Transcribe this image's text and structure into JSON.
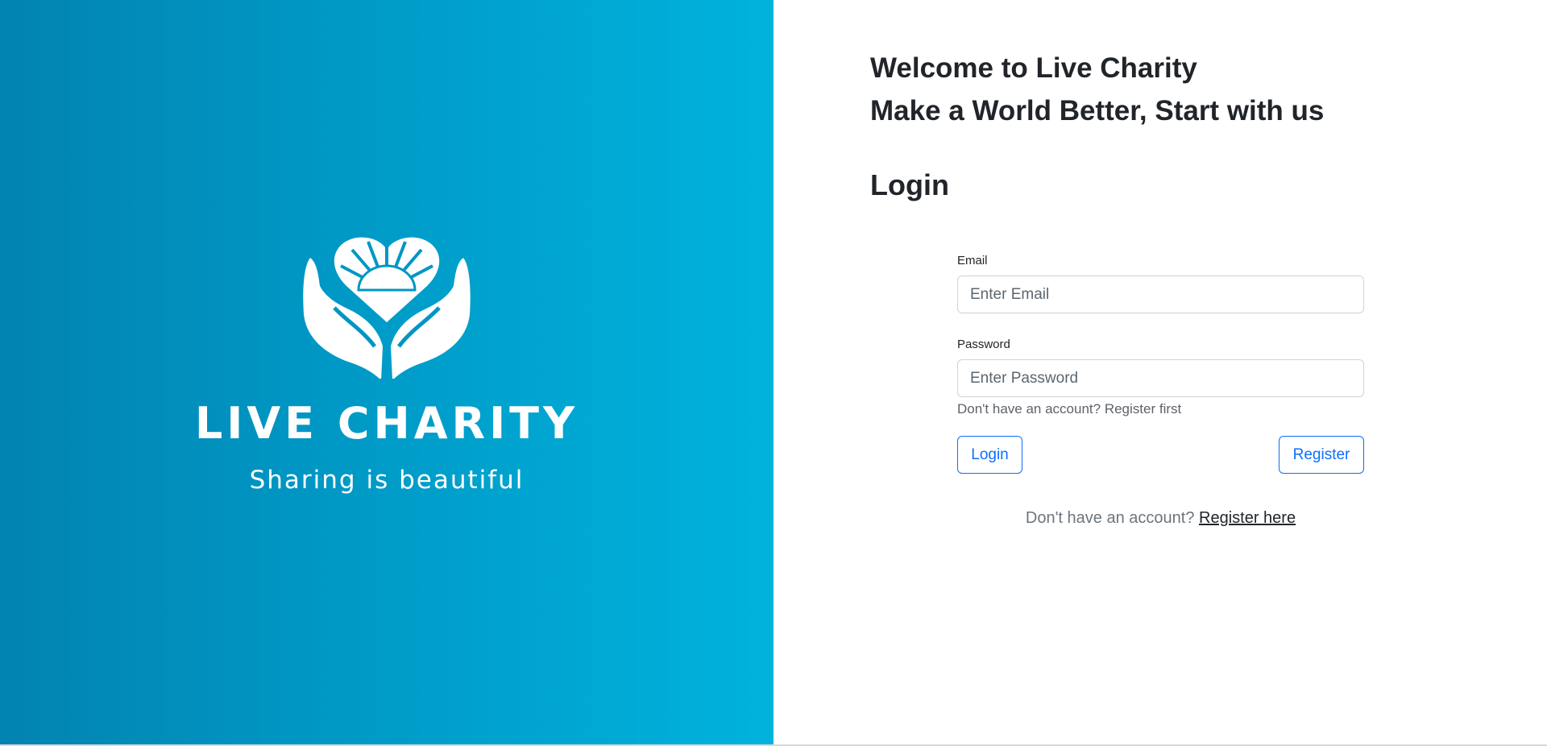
{
  "brand": {
    "name": "LIVE CHARITY",
    "tagline": "Sharing is beautiful",
    "gradient_start": "#0283b1",
    "gradient_end": "#00b3dd"
  },
  "header": {
    "welcome_line1": "Welcome to Live Charity",
    "welcome_line2": "Make a World Better, Start with us",
    "login_heading": "Login"
  },
  "form": {
    "email": {
      "label": "Email",
      "placeholder": "Enter Email",
      "value": ""
    },
    "password": {
      "label": "Password",
      "placeholder": "Enter Password",
      "value": ""
    },
    "hint": "Don't have an account? Register first",
    "login_button": "Login",
    "register_button": "Register",
    "accent_color": "#0d6efd"
  },
  "footer": {
    "prompt": "Don't have an account?",
    "link": "Register here"
  }
}
